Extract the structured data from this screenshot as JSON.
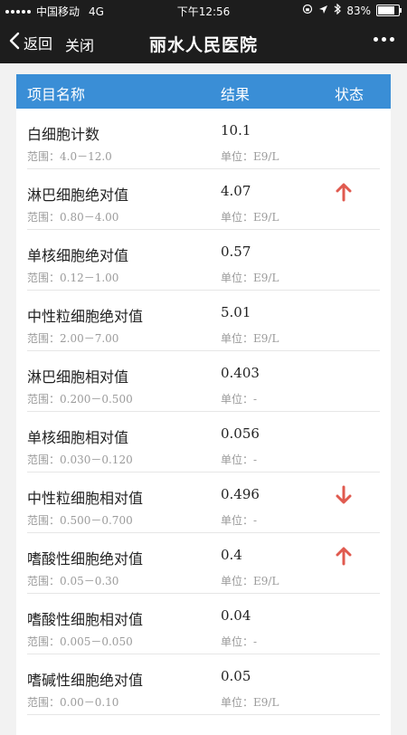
{
  "status_bar": {
    "carrier": "中国移动",
    "network": "4G",
    "time": "下午12:56",
    "battery": "83%",
    "battery_level": 0.83
  },
  "navbar": {
    "back_label": "返回",
    "close_label": "关闭",
    "title": "丽水人民医院"
  },
  "table": {
    "headers": {
      "name": "项目名称",
      "result": "结果",
      "status": "状态"
    },
    "rows": [
      {
        "name": "白细胞计数",
        "value": "10.1",
        "range": "范围：4.0－12.0",
        "unit": "单位：E9/L",
        "status": ""
      },
      {
        "name": "淋巴细胞绝对值",
        "value": "4.07",
        "range": "范围：0.80－4.00",
        "unit": "单位：E9/L",
        "status": "up"
      },
      {
        "name": "单核细胞绝对值",
        "value": "0.57",
        "range": "范围：0.12－1.00",
        "unit": "单位：E9/L",
        "status": ""
      },
      {
        "name": "中性粒细胞绝对值",
        "value": "5.01",
        "range": "范围：2.00－7.00",
        "unit": "单位：E9/L",
        "status": ""
      },
      {
        "name": "淋巴细胞相对值",
        "value": "0.403",
        "range": "范围：0.200－0.500",
        "unit": "单位：-",
        "status": ""
      },
      {
        "name": "单核细胞相对值",
        "value": "0.056",
        "range": "范围：0.030－0.120",
        "unit": "单位：-",
        "status": ""
      },
      {
        "name": "中性粒细胞相对值",
        "value": "0.496",
        "range": "范围：0.500－0.700",
        "unit": "单位：-",
        "status": "down"
      },
      {
        "name": "嗜酸性细胞绝对值",
        "value": "0.4",
        "range": "范围：0.05－0.30",
        "unit": "单位：E9/L",
        "status": "up"
      },
      {
        "name": "嗜酸性细胞相对值",
        "value": "0.04",
        "range": "范围：0.005－0.050",
        "unit": "单位：-",
        "status": ""
      },
      {
        "name": "嗜碱性细胞绝对值",
        "value": "0.05",
        "range": "范围：0.00－0.10",
        "unit": "单位：E9/L",
        "status": ""
      }
    ]
  },
  "colors": {
    "header_bg": "#3a8ed6",
    "arrow": "#e05a4f",
    "navbar_bg": "#1d1d1d"
  }
}
